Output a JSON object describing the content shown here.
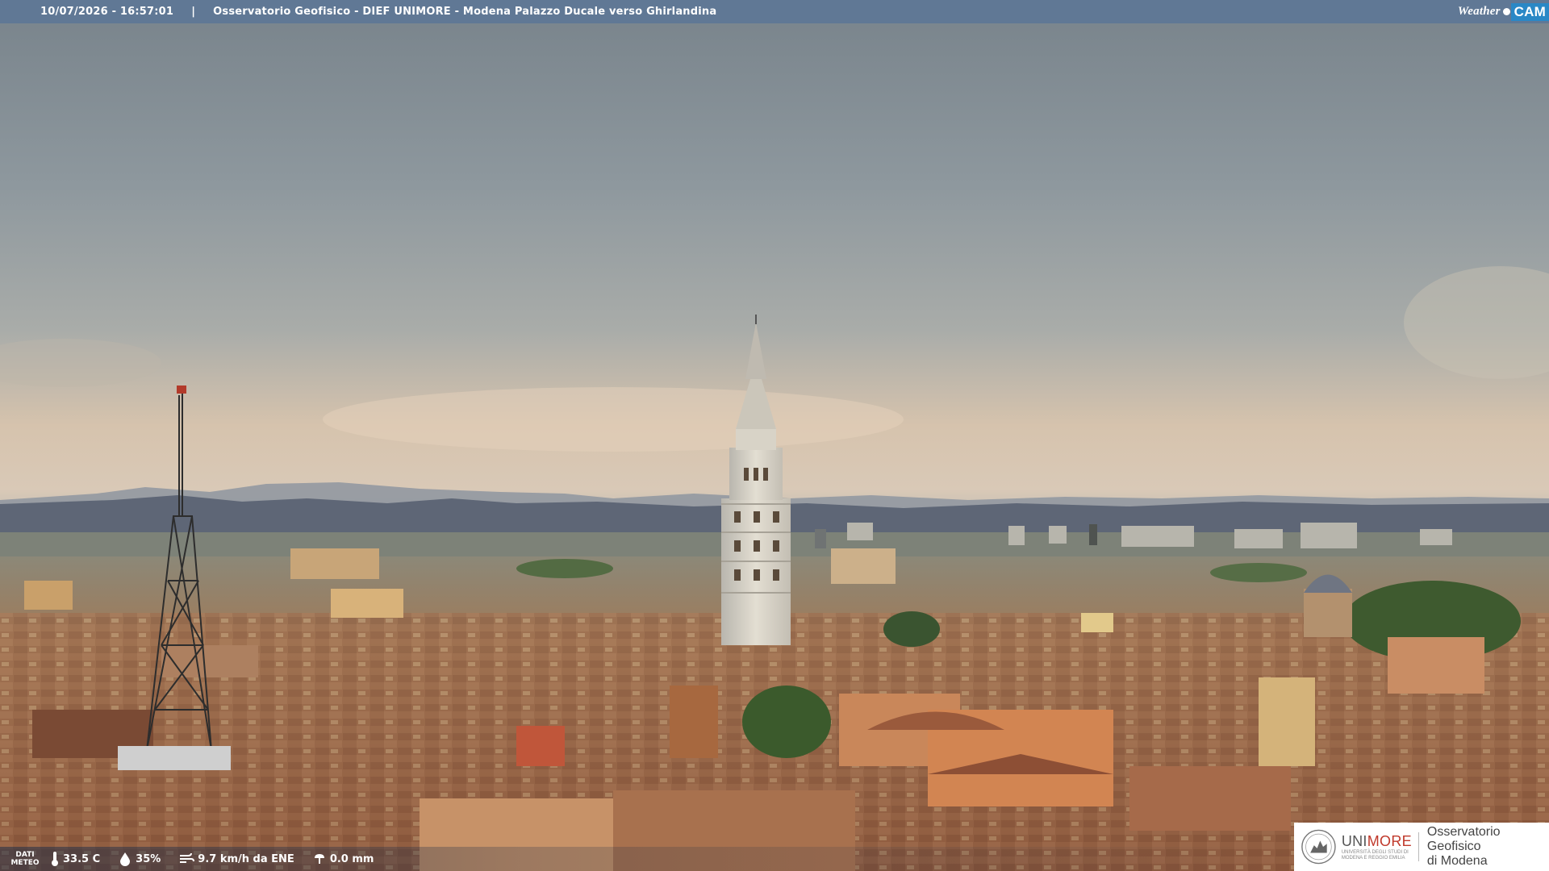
{
  "overlay": {
    "timestamp": "10/07/2026 - 16:57:01",
    "separator": "|",
    "title": "Osservatorio Geofisico - DIEF UNIMORE - Modena Palazzo Ducale verso Ghirlandina",
    "logo_left": "Weather",
    "logo_right": "CAM"
  },
  "weather": {
    "label_line1": "DATI",
    "label_line2": "METEO",
    "temperature": "33.5 C",
    "humidity": "35%",
    "wind": "9.7 km/h da ENE",
    "rain": "0.0 mm",
    "icons": [
      "thermometer-icon",
      "humidity-drop-icon",
      "wind-icon",
      "rain-icon"
    ]
  },
  "branding": {
    "uni_part1": "UNI",
    "uni_part2": "MORE",
    "uni_subtitle": "UNIVERSITÀ DEGLI STUDI DI MODENA E REGGIO EMILIA",
    "observatory_line1": "Osservatorio Geofisico",
    "observatory_line2": "di Modena",
    "colors": {
      "accent_red": "#c0392b",
      "topbar": "#5c7696",
      "cam_blue": "#2a88c6"
    }
  }
}
